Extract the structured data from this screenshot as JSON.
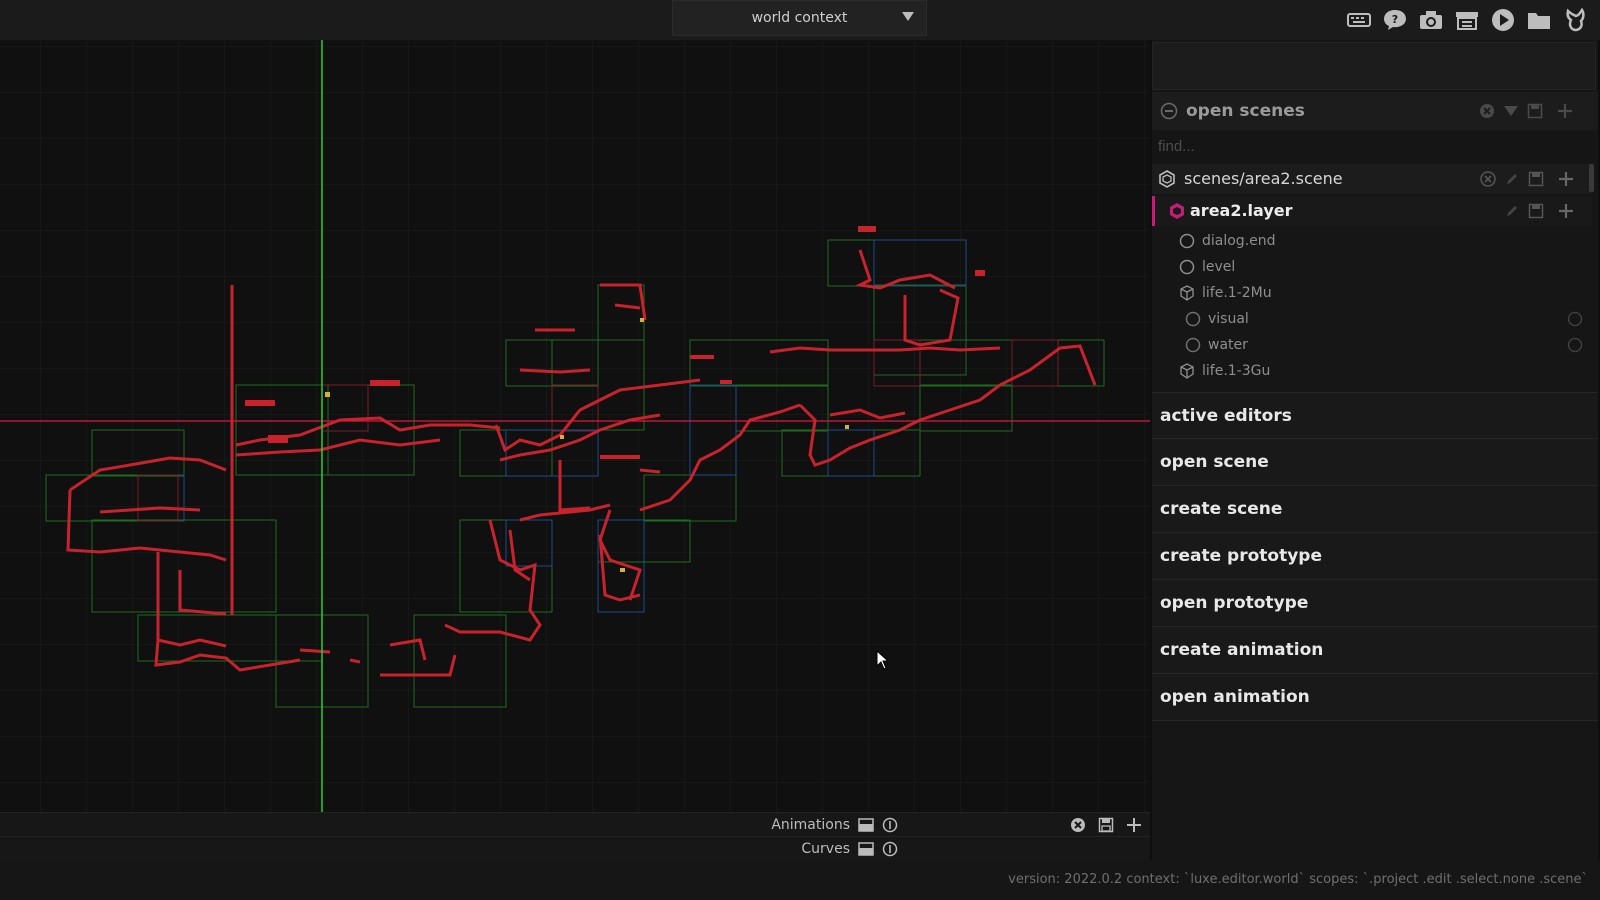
{
  "topbar": {
    "context_label": "world context",
    "tool_icons": [
      "keyboard-icon",
      "help-icon",
      "camera-icon",
      "build-icon",
      "play-icon",
      "folder-icon",
      "logo-icon"
    ]
  },
  "scenes_panel": {
    "title": "open scenes",
    "find_placeholder": "find...",
    "scene_name": "scenes/area2.scene",
    "layer_name": "area2.layer",
    "items": [
      {
        "label": "dialog.end",
        "icon": "circle-icon"
      },
      {
        "label": "level",
        "icon": "circle-icon"
      },
      {
        "label": "life.1-2Mu",
        "icon": "cube-icon"
      },
      {
        "label": "visual",
        "icon": "circle-icon"
      },
      {
        "label": "water",
        "icon": "circle-icon"
      },
      {
        "label": "life.1-3Gu",
        "icon": "cube-icon"
      }
    ]
  },
  "menu": {
    "items": [
      "active editors",
      "open scene",
      "create scene",
      "create prototype",
      "open prototype",
      "create animation",
      "open animation"
    ]
  },
  "bottom_panels": {
    "animations_label": "Animations",
    "curves_label": "Curves"
  },
  "status": {
    "text": "version: 2022.0.2 context: `luxe.editor.world` scopes: `.project .edit .select.none .scene`"
  },
  "colors": {
    "accent_layer": "#c51c78",
    "axis_x": "#d81b3c",
    "axis_y": "#2ecc2e",
    "level_stroke": "#c8232d"
  }
}
